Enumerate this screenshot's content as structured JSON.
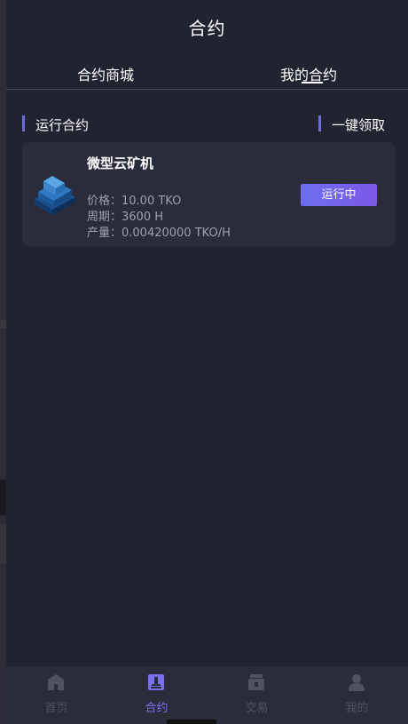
{
  "header": {
    "title": "合约"
  },
  "tabs": {
    "market": "合约商城",
    "mine": "我的合约",
    "active": "mine"
  },
  "section": {
    "title": "运行合约",
    "claim_all": "一键领取"
  },
  "contracts": [
    {
      "name": "微型云矿机",
      "price": "价格：10.00 TKO",
      "period": "周期：3600 H",
      "output": "产量：0.00420000 TKO/H",
      "status": "运行中",
      "icon": "mining-machine-icon"
    }
  ],
  "bottom_nav": [
    {
      "label": "首页",
      "icon": "home-icon",
      "active": false
    },
    {
      "label": "合约",
      "icon": "contract-icon",
      "active": true
    },
    {
      "label": "交易",
      "icon": "trade-icon",
      "active": false
    },
    {
      "label": "我的",
      "icon": "user-icon",
      "active": false
    }
  ],
  "colors": {
    "background": "#222331",
    "card": "#2a2b3b",
    "accent": "#6f6fd8",
    "active_nav": "#7b71f0",
    "button_gradient_start": "#6b6ff0",
    "button_gradient_end": "#7c58e6"
  }
}
